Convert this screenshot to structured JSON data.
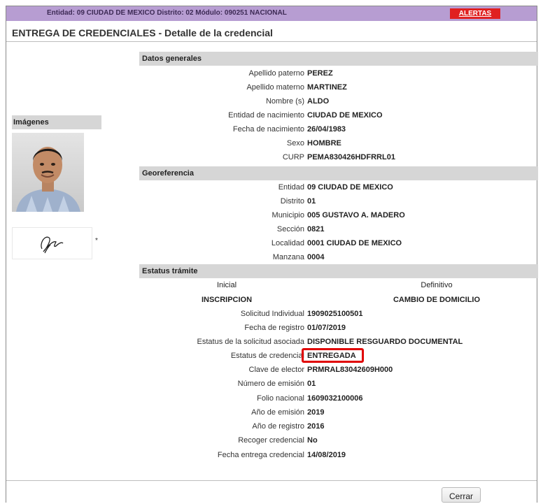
{
  "topbar": {
    "location_text": "Entidad: 09 CIUDAD DE MEXICO Distrito: 02 Módulo: 090251 NACIONAL",
    "alerts_label": "ALERTAS"
  },
  "page": {
    "title": "ENTREGA DE CREDENCIALES - Detalle de la credencial"
  },
  "images": {
    "header": "Imágenes",
    "asterisk": "*"
  },
  "datos_generales": {
    "header": "Datos generales",
    "rows": [
      {
        "label": "Apellido paterno",
        "value": "PEREZ"
      },
      {
        "label": "Apellido materno",
        "value": "MARTINEZ"
      },
      {
        "label": "Nombre (s)",
        "value": "ALDO"
      },
      {
        "label": "Entidad de nacimiento",
        "value": "CIUDAD DE MEXICO"
      },
      {
        "label": "Fecha de nacimiento",
        "value": "26/04/1983"
      },
      {
        "label": "Sexo",
        "value": "HOMBRE"
      },
      {
        "label": "CURP",
        "value": "PEMA830426HDFRRL01"
      }
    ]
  },
  "georeferencia": {
    "header": "Georeferencia",
    "rows": [
      {
        "label": "Entidad",
        "value": "09 CIUDAD DE MEXICO"
      },
      {
        "label": "Distrito",
        "value": "01"
      },
      {
        "label": "Municipio",
        "value": "005 GUSTAVO A. MADERO"
      },
      {
        "label": "Sección",
        "value": "0821"
      },
      {
        "label": "Localidad",
        "value": "0001 CIUDAD DE MEXICO"
      },
      {
        "label": "Manzana",
        "value": "0004"
      }
    ]
  },
  "estatus_tramite": {
    "header": "Estatus trámite",
    "inicial_label": "Inicial",
    "definitivo_label": "Definitivo",
    "inicial_value": "INSCRIPCION",
    "definitivo_value": "CAMBIO DE DOMICILIO",
    "rows": [
      {
        "label": "Solicitud Individual",
        "value": "1909025100501"
      },
      {
        "label": "Fecha de registro",
        "value": "01/07/2019"
      },
      {
        "label": "Estatus de la solicitud asociada",
        "value": "DISPONIBLE RESGUARDO DOCUMENTAL"
      },
      {
        "label": "Estatus de credencial",
        "value": "ENTREGADA"
      },
      {
        "label": "Clave de elector",
        "value": "PRMRAL83042609H000"
      },
      {
        "label": "Número de emisión",
        "value": "01"
      },
      {
        "label": "Folio nacional",
        "value": "1609032100006"
      },
      {
        "label": "Año de emisión",
        "value": "2019"
      },
      {
        "label": "Año de registro",
        "value": "2016"
      },
      {
        "label": "Recoger credencial",
        "value": "No"
      },
      {
        "label": "Fecha entrega credencial",
        "value": "14/08/2019"
      }
    ]
  },
  "footer": {
    "close_label": "Cerrar"
  },
  "colors": {
    "topbar": "#b79dd2",
    "alert": "#e02020",
    "section_header": "#d6d6d6",
    "highlight": "#e00000"
  }
}
